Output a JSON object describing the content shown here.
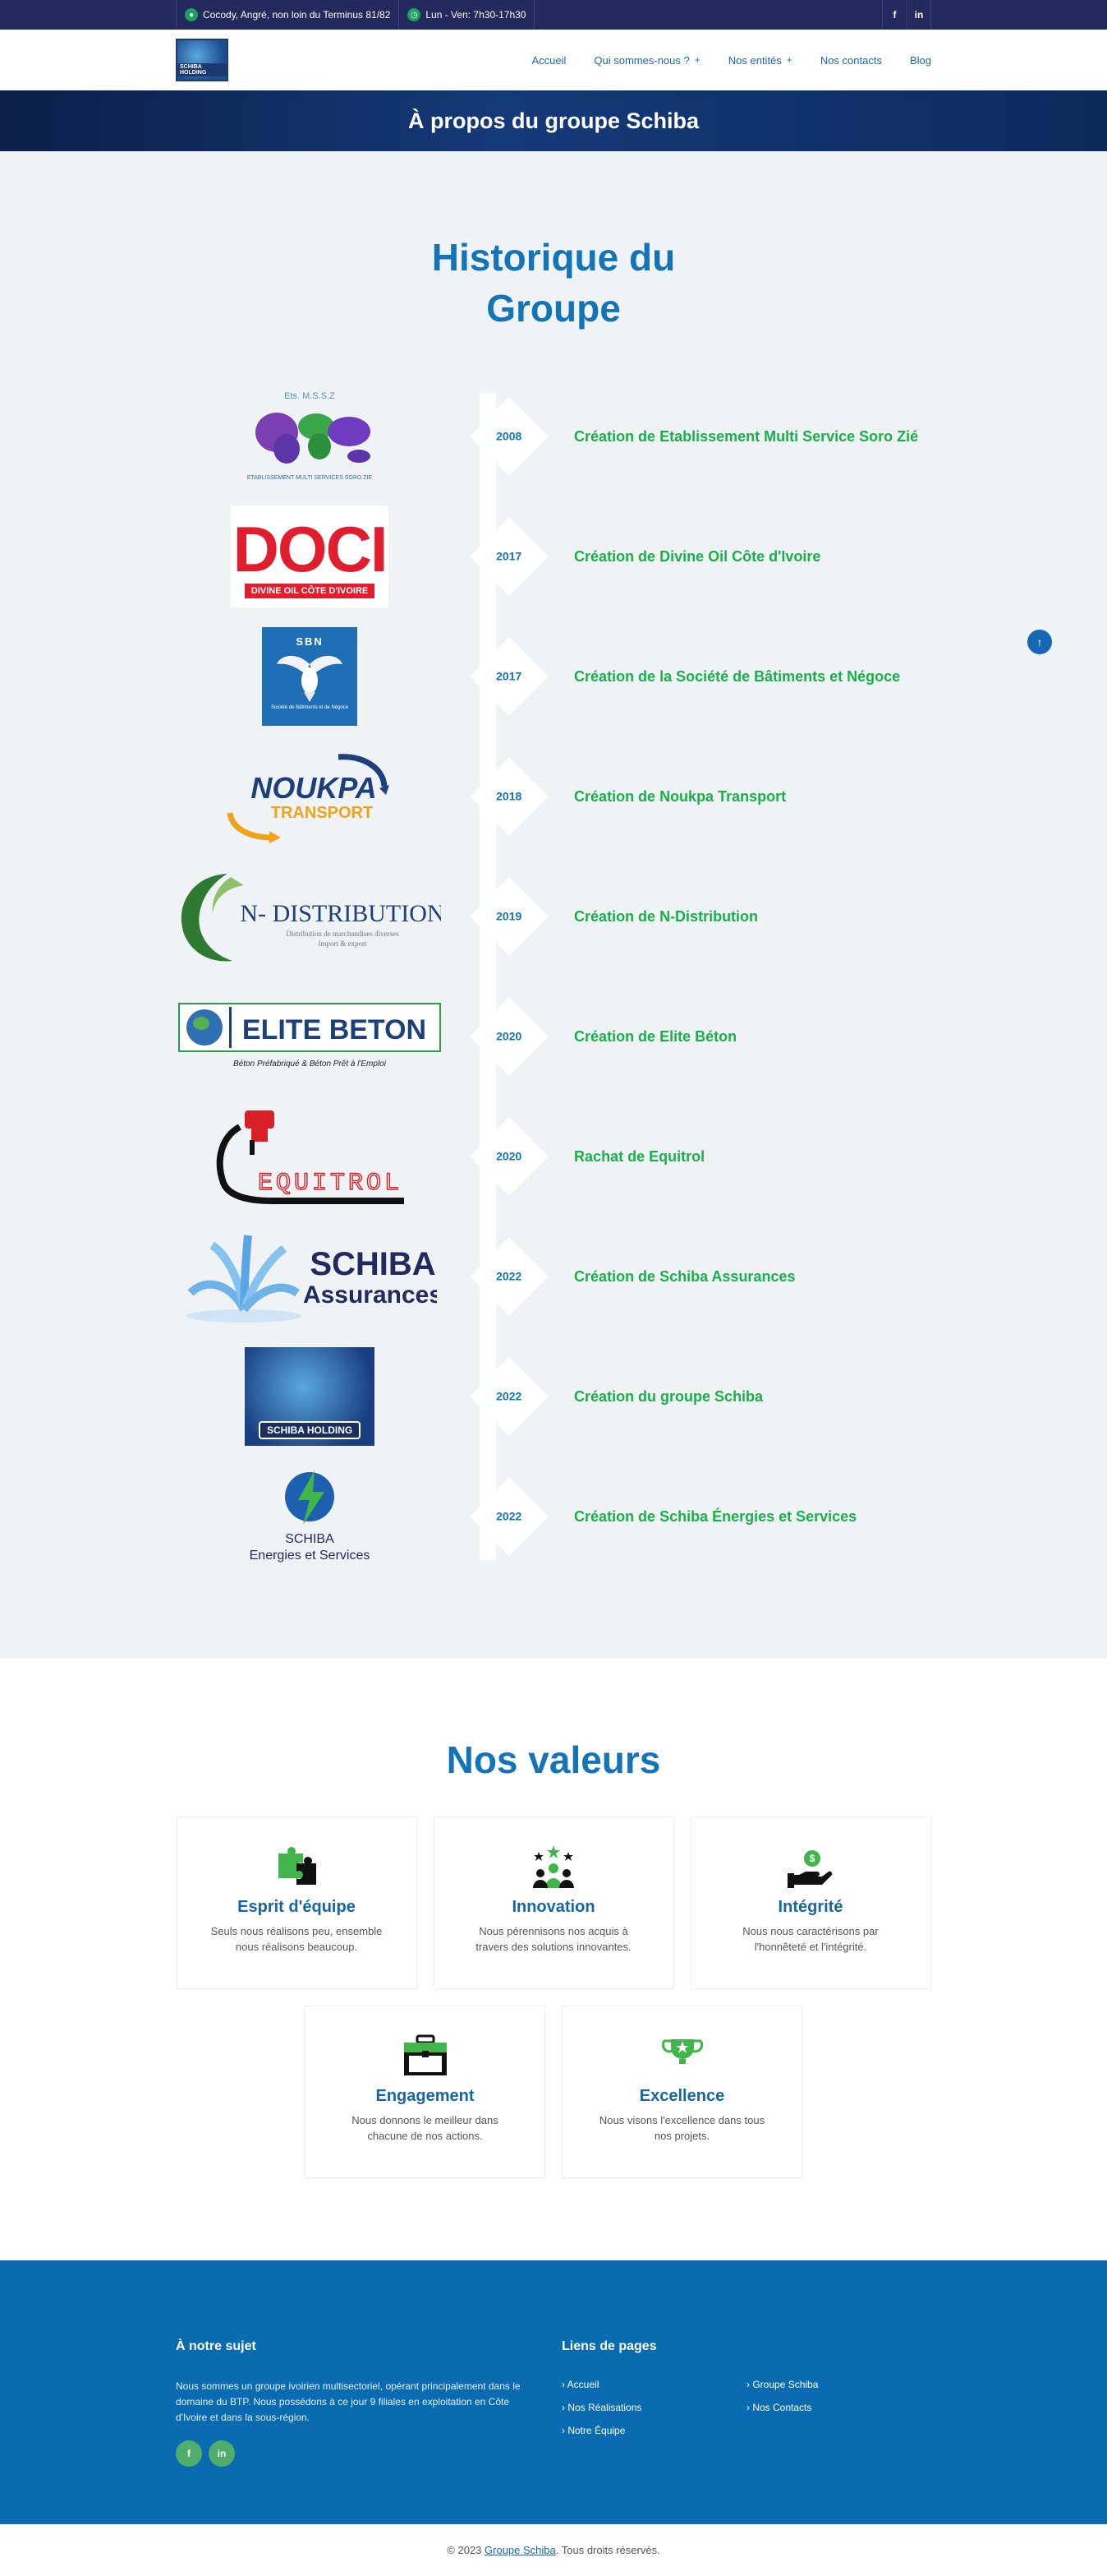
{
  "topbar": {
    "address": "Cocody, Angré, non loin du Terminus 81/82",
    "hours": "Lun - Ven: 7h30-17h30",
    "social": [
      "f",
      "in"
    ]
  },
  "nav": {
    "logo_text": "SCHIBA HOLDING",
    "items": [
      {
        "label": "Accueil",
        "dropdown": false
      },
      {
        "label": "Qui sommes-nous ?",
        "dropdown": true
      },
      {
        "label": "Nos entités",
        "dropdown": true
      },
      {
        "label": "Nos contacts",
        "dropdown": false
      },
      {
        "label": "Blog",
        "dropdown": false
      }
    ]
  },
  "hero": {
    "title": "À propos du groupe Schiba"
  },
  "history": {
    "heading": "Historique du Groupe",
    "events": [
      {
        "year": "2008",
        "title": "Création de Etablissement Multi Service Soro Zié",
        "logo": "ets-mssz-logo"
      },
      {
        "year": "2017",
        "title": "Création de Divine Oil Côte d'Ivoire",
        "logo": "doci-logo"
      },
      {
        "year": "2017",
        "title": "Création de la Société de Bâtiments et Négoce",
        "logo": "sbn-logo"
      },
      {
        "year": "2018",
        "title": "Création de Noukpa Transport",
        "logo": "noukpa-logo"
      },
      {
        "year": "2019",
        "title": "Création de N-Distribution",
        "logo": "n-distribution-logo"
      },
      {
        "year": "2020",
        "title": "Création de Elite Béton",
        "logo": "elite-beton-logo"
      },
      {
        "year": "2020",
        "title": "Rachat de Equitrol",
        "logo": "equitrol-logo"
      },
      {
        "year": "2022",
        "title": "Création de Schiba Assurances",
        "logo": "schiba-assurances-logo"
      },
      {
        "year": "2022",
        "title": "Création du groupe Schiba",
        "logo": "schiba-holding-logo"
      },
      {
        "year": "2022",
        "title": "Création de Schiba Énergies et Services",
        "logo": "schiba-energies-logo"
      }
    ],
    "logo_texts": {
      "mssz_top": "Ets. M.S.S.Z",
      "mssz_bottom": "ETABLISSEMENT MULTI SERVICES SORO ZIE",
      "doci_big": "DOCI",
      "doci_bar": "DIVINE OIL CÔTE D'IVOIRE",
      "sbn": "SBN",
      "sbn_sub": "Société de Bâtiments et de Négoce",
      "noukpa_1": "NOUKPA",
      "noukpa_2": "TRANSPORT",
      "nd_1": "N- DISTRIBUTION",
      "nd_2": "Distribution de marchandises diverses",
      "nd_3": "Import & export",
      "elite_1": "ELITE BETON",
      "elite_2": "Béton Préfabriqué & Béton Prêt à l'Emploi",
      "equitrol": "EQUITROL",
      "assur_1": "SCHIBA",
      "assur_2": "Assurances",
      "holding": "SCHIBA HOLDING",
      "energie_1": "SCHIBA",
      "energie_2": "Energies et Services"
    }
  },
  "values": {
    "heading": "Nos valeurs",
    "items": [
      {
        "title": "Esprit d'équipe",
        "text": "Seuls nous réalisons peu, ensemble nous réalisons beaucoup.",
        "icon": "puzzle-icon"
      },
      {
        "title": "Innovation",
        "text": "Nous pérennisons nos acquis à travers des solutions innovantes.",
        "icon": "team-stars-icon"
      },
      {
        "title": "Intégrité",
        "text": "Nous nous caractérisons par l'honnêteté et l'intégrité.",
        "icon": "hand-coin-icon"
      },
      {
        "title": "Engagement",
        "text": "Nous donnons le meilleur dans chacune de nos actions.",
        "icon": "briefcase-icon"
      },
      {
        "title": "Excellence",
        "text": "Nous visons l'excellence dans tous nos projets.",
        "icon": "trophy-icon"
      }
    ]
  },
  "footer": {
    "about_title": "À notre sujet",
    "about_text": "Nous sommes un groupe ivoirien multisectoriel, opérant principalement dans le domaine du BTP. Nous possédons à ce jour 9 filiales en exploitation en Côte d'Ivoire et dans la sous-région.",
    "links_title": "Liens de pages",
    "links": [
      "Accueil",
      "Groupe Schiba",
      "Nos Réalisations",
      "Nos Contacts",
      "Notre Équipe"
    ],
    "social": [
      "f",
      "in"
    ]
  },
  "copyright": {
    "prefix": "© 2023 ",
    "brand": "Groupe Schiba",
    "suffix": ". Tous droits réservés."
  },
  "colors": {
    "accent": "#1474b8",
    "green": "#19b04a",
    "topbar": "#24295e",
    "footer": "#0b6bb1"
  }
}
